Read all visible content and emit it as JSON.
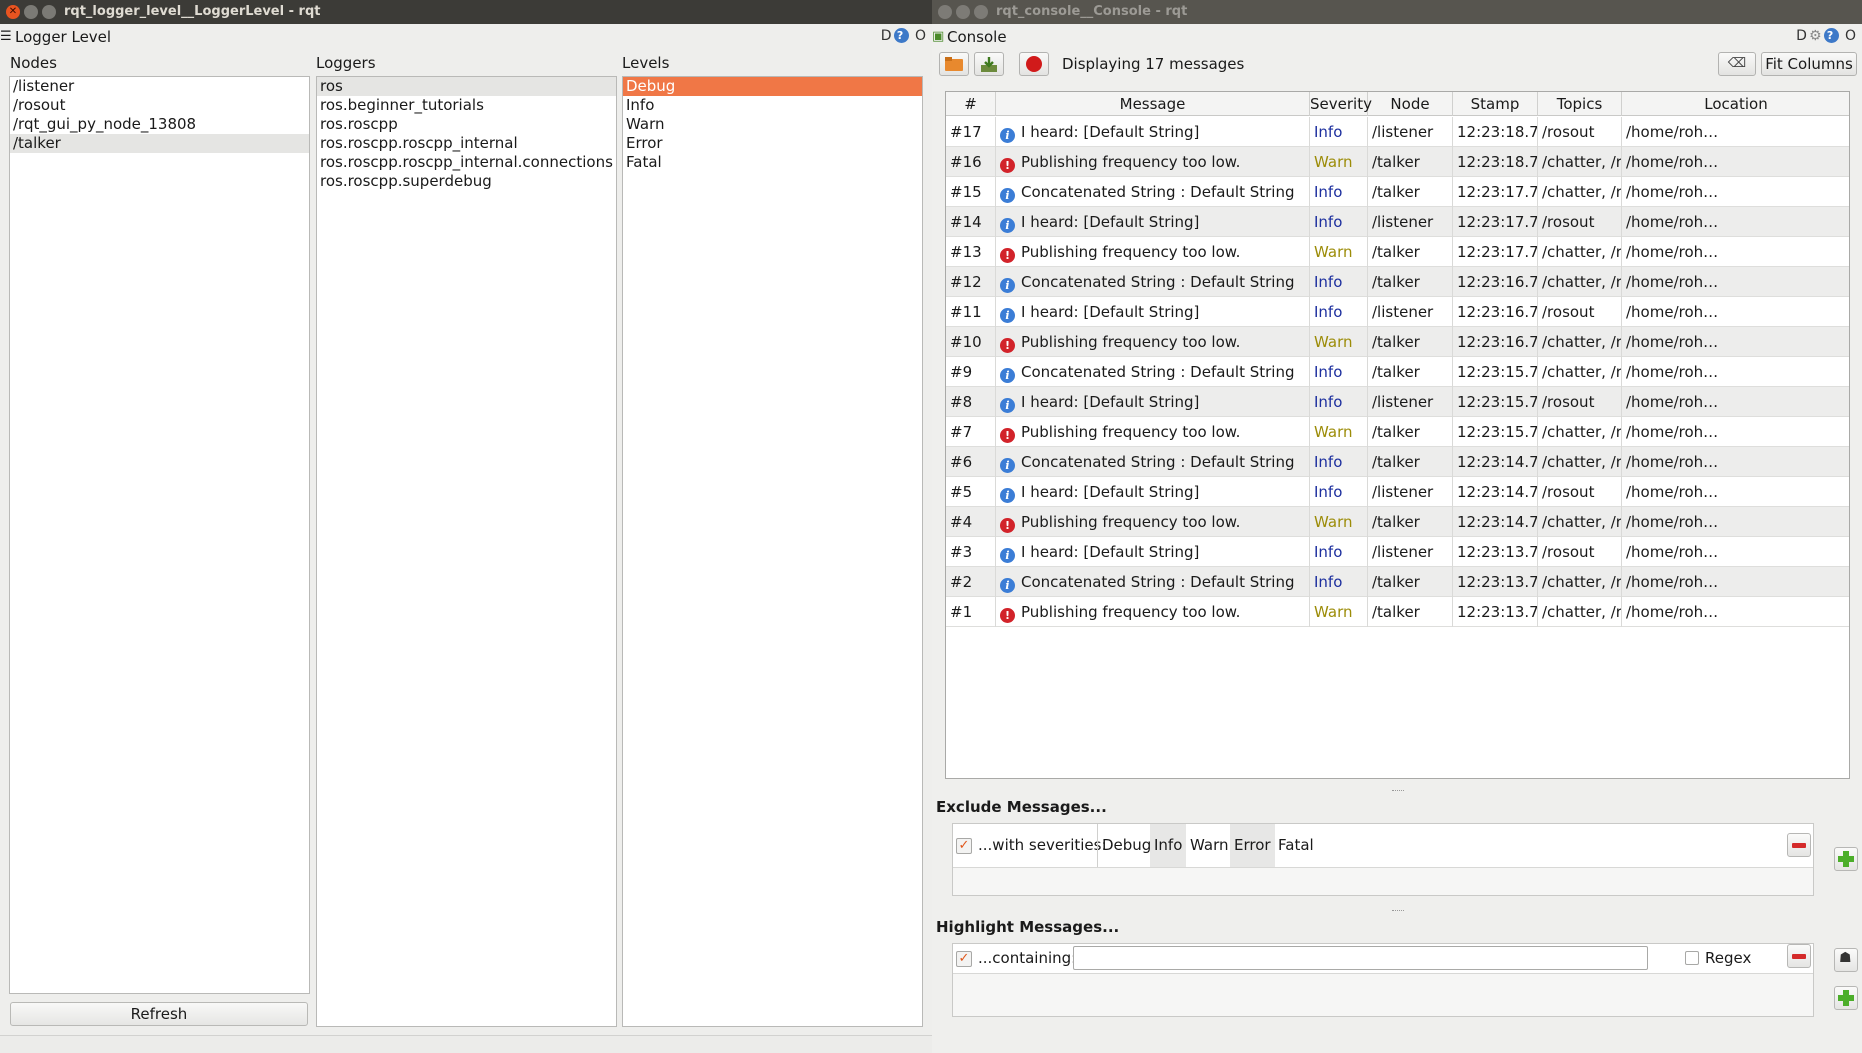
{
  "left_window": {
    "title": "rqt_logger_level__LoggerLevel - rqt",
    "dock_title": "Logger Level",
    "dock_controls": "D",
    "dock_close": "O",
    "nodes_header": "Nodes",
    "loggers_header": "Loggers",
    "levels_header": "Levels",
    "nodes": [
      "/listener",
      "/rosout",
      "/rqt_gui_py_node_13808",
      "/talker"
    ],
    "selected_node": 3,
    "loggers": [
      "ros",
      "ros.beginner_tutorials",
      "ros.roscpp",
      "ros.roscpp.roscpp_internal",
      "ros.roscpp.roscpp_internal.connections",
      "ros.roscpp.superdebug"
    ],
    "selected_logger": 0,
    "levels": [
      "Debug",
      "Info",
      "Warn",
      "Error",
      "Fatal"
    ],
    "selected_level": 0,
    "refresh_label": "Refresh"
  },
  "right_window": {
    "title": "rqt_console__Console - rqt",
    "dock_title": "Console",
    "dock_controls": "D",
    "dock_close": "O",
    "status_text": "Displaying 17 messages",
    "fit_columns_label": "Fit Columns",
    "columns": [
      "#",
      "Message",
      "Severity",
      "Node",
      "Stamp",
      "Topics",
      "Location"
    ],
    "messages": [
      {
        "num": "#17",
        "message": "I heard: [Default String]",
        "severity": "Info",
        "node": "/listener",
        "stamp": "12:23:18.7…",
        "topics": "/rosout",
        "location": "/home/roh…"
      },
      {
        "num": "#16",
        "message": "Publishing frequency too low.",
        "severity": "Warn",
        "node": "/talker",
        "stamp": "12:23:18.7…",
        "topics": "/chatter, /r…",
        "location": "/home/roh…"
      },
      {
        "num": "#15",
        "message": "Concatenated String : Default String",
        "severity": "Info",
        "node": "/talker",
        "stamp": "12:23:17.7…",
        "topics": "/chatter, /r…",
        "location": "/home/roh…"
      },
      {
        "num": "#14",
        "message": "I heard: [Default String]",
        "severity": "Info",
        "node": "/listener",
        "stamp": "12:23:17.7…",
        "topics": "/rosout",
        "location": "/home/roh…"
      },
      {
        "num": "#13",
        "message": "Publishing frequency too low.",
        "severity": "Warn",
        "node": "/talker",
        "stamp": "12:23:17.7…",
        "topics": "/chatter, /r…",
        "location": "/home/roh…"
      },
      {
        "num": "#12",
        "message": "Concatenated String : Default String",
        "severity": "Info",
        "node": "/talker",
        "stamp": "12:23:16.7…",
        "topics": "/chatter, /r…",
        "location": "/home/roh…"
      },
      {
        "num": "#11",
        "message": "I heard: [Default String]",
        "severity": "Info",
        "node": "/listener",
        "stamp": "12:23:16.7…",
        "topics": "/rosout",
        "location": "/home/roh…"
      },
      {
        "num": "#10",
        "message": "Publishing frequency too low.",
        "severity": "Warn",
        "node": "/talker",
        "stamp": "12:23:16.7…",
        "topics": "/chatter, /r…",
        "location": "/home/roh…"
      },
      {
        "num": "#9",
        "message": "Concatenated String : Default String",
        "severity": "Info",
        "node": "/talker",
        "stamp": "12:23:15.7…",
        "topics": "/chatter, /r…",
        "location": "/home/roh…"
      },
      {
        "num": "#8",
        "message": "I heard: [Default String]",
        "severity": "Info",
        "node": "/listener",
        "stamp": "12:23:15.7…",
        "topics": "/rosout",
        "location": "/home/roh…"
      },
      {
        "num": "#7",
        "message": "Publishing frequency too low.",
        "severity": "Warn",
        "node": "/talker",
        "stamp": "12:23:15.7…",
        "topics": "/chatter, /r…",
        "location": "/home/roh…"
      },
      {
        "num": "#6",
        "message": "Concatenated String : Default String",
        "severity": "Info",
        "node": "/talker",
        "stamp": "12:23:14.7…",
        "topics": "/chatter, /r…",
        "location": "/home/roh…"
      },
      {
        "num": "#5",
        "message": "I heard: [Default String]",
        "severity": "Info",
        "node": "/listener",
        "stamp": "12:23:14.7…",
        "topics": "/rosout",
        "location": "/home/roh…"
      },
      {
        "num": "#4",
        "message": "Publishing frequency too low.",
        "severity": "Warn",
        "node": "/talker",
        "stamp": "12:23:14.7…",
        "topics": "/chatter, /r…",
        "location": "/home/roh…"
      },
      {
        "num": "#3",
        "message": "I heard: [Default String]",
        "severity": "Info",
        "node": "/listener",
        "stamp": "12:23:13.7…",
        "topics": "/rosout",
        "location": "/home/roh…"
      },
      {
        "num": "#2",
        "message": "Concatenated String : Default String",
        "severity": "Info",
        "node": "/talker",
        "stamp": "12:23:13.7…",
        "topics": "/chatter, /r…",
        "location": "/home/roh…"
      },
      {
        "num": "#1",
        "message": "Publishing frequency too low.",
        "severity": "Warn",
        "node": "/talker",
        "stamp": "12:23:13.7…",
        "topics": "/chatter, /r…",
        "location": "/home/roh…"
      }
    ],
    "exclude": {
      "title": "Exclude Messages...",
      "label": "...with severities:",
      "severities": [
        "Debug",
        "Info",
        "Warn",
        "Error",
        "Fatal"
      ],
      "active": [
        false,
        true,
        false,
        true,
        false
      ]
    },
    "highlight": {
      "title": "Highlight Messages...",
      "label": "...containing:",
      "value": "",
      "regex_label": "Regex"
    }
  },
  "colors": {
    "accent": "#f07746",
    "info": "#1d2f9e",
    "warn": "#9c8c08",
    "error_icon": "#d2232a",
    "info_icon": "#3b7dd6"
  }
}
